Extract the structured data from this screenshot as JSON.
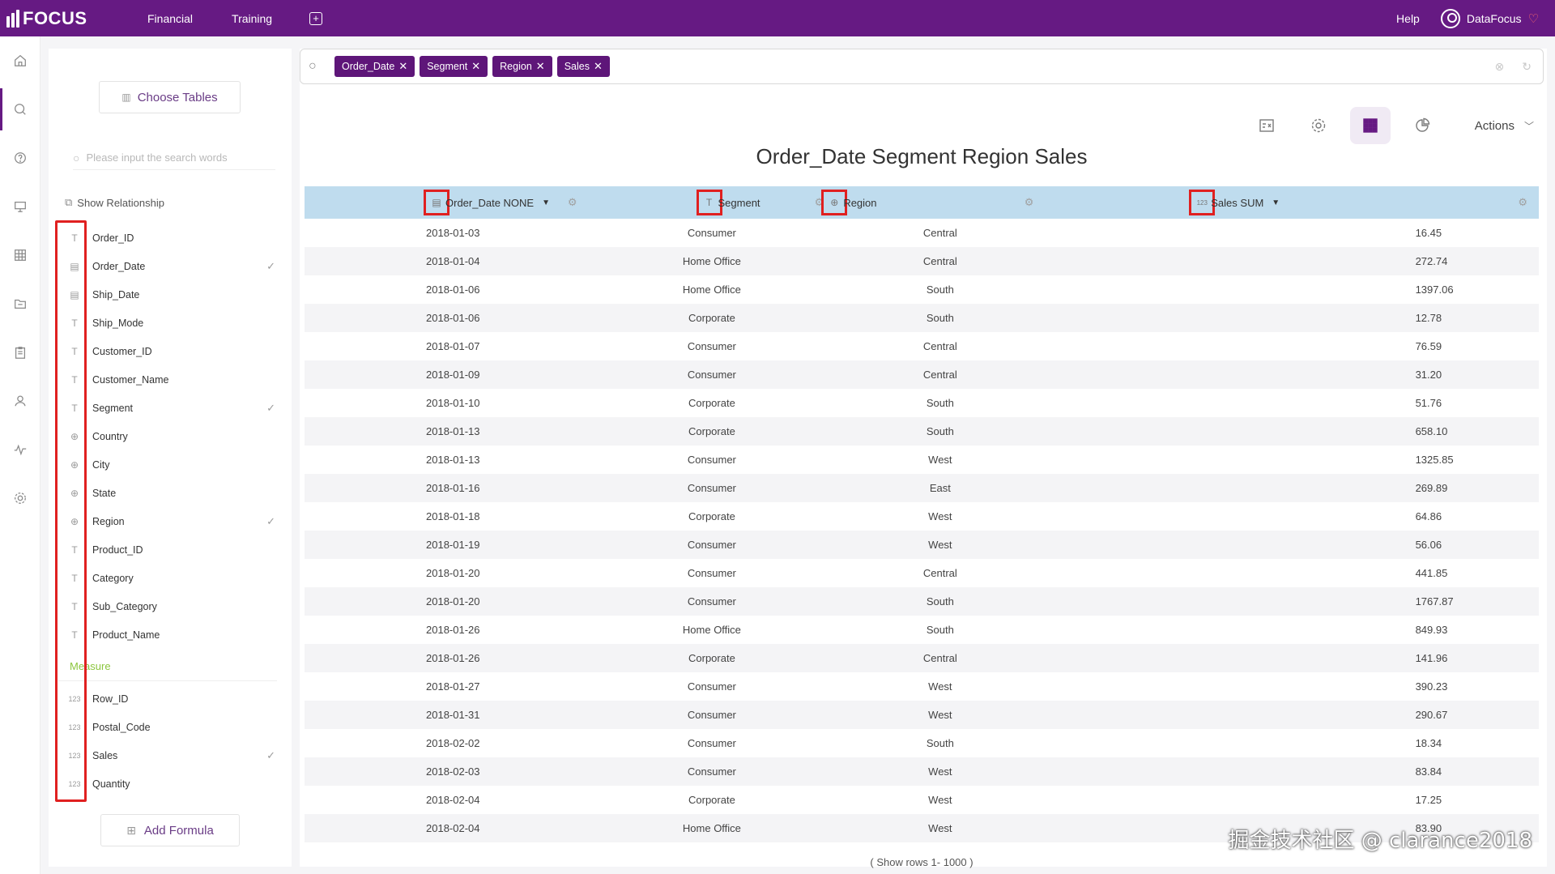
{
  "app": {
    "logo_text": "FOCUS",
    "user_name": "DataFocus"
  },
  "topnav": {
    "items": [
      "Financial",
      "Training"
    ],
    "help": "Help"
  },
  "panel": {
    "choose_tables": "Choose Tables",
    "search_placeholder": "Please input the search words",
    "show_relationship": "Show Relationship",
    "attribute_fields": [
      {
        "name": "Order_ID",
        "type": "text",
        "checked": false
      },
      {
        "name": "Order_Date",
        "type": "date",
        "checked": true
      },
      {
        "name": "Ship_Date",
        "type": "date",
        "checked": false
      },
      {
        "name": "Ship_Mode",
        "type": "text",
        "checked": false
      },
      {
        "name": "Customer_ID",
        "type": "text",
        "checked": false
      },
      {
        "name": "Customer_Name",
        "type": "text",
        "checked": false
      },
      {
        "name": "Segment",
        "type": "text",
        "checked": true
      },
      {
        "name": "Country",
        "type": "geo",
        "checked": false
      },
      {
        "name": "City",
        "type": "geo",
        "checked": false
      },
      {
        "name": "State",
        "type": "geo",
        "checked": false
      },
      {
        "name": "Region",
        "type": "geo",
        "checked": true
      },
      {
        "name": "Product_ID",
        "type": "text",
        "checked": false
      },
      {
        "name": "Category",
        "type": "text",
        "checked": false
      },
      {
        "name": "Sub_Category",
        "type": "text",
        "checked": false
      },
      {
        "name": "Product_Name",
        "type": "text",
        "checked": false
      }
    ],
    "measure_label": "Measure",
    "measure_fields": [
      {
        "name": "Row_ID",
        "type": "number",
        "checked": false
      },
      {
        "name": "Postal_Code",
        "type": "number",
        "checked": false
      },
      {
        "name": "Sales",
        "type": "number",
        "checked": true
      },
      {
        "name": "Quantity",
        "type": "number",
        "checked": false
      }
    ],
    "add_formula": "Add Formula"
  },
  "search": {
    "chips": [
      "Order_Date",
      "Segment",
      "Region",
      "Sales"
    ]
  },
  "toolbar": {
    "actions_label": "Actions"
  },
  "result": {
    "title": "Order_Date Segment Region Sales",
    "columns": [
      {
        "label": "Order_Date NONE",
        "icon": "date",
        "sortable": true
      },
      {
        "label": "Segment",
        "icon": "text",
        "sortable": false
      },
      {
        "label": "Region",
        "icon": "geo",
        "sortable": false
      },
      {
        "label": "Sales SUM",
        "icon": "number",
        "sortable": true
      }
    ],
    "rows": [
      [
        "2018-01-03",
        "Consumer",
        "Central",
        "16.45"
      ],
      [
        "2018-01-04",
        "Home Office",
        "Central",
        "272.74"
      ],
      [
        "2018-01-06",
        "Home Office",
        "South",
        "1397.06"
      ],
      [
        "2018-01-06",
        "Corporate",
        "South",
        "12.78"
      ],
      [
        "2018-01-07",
        "Consumer",
        "Central",
        "76.59"
      ],
      [
        "2018-01-09",
        "Consumer",
        "Central",
        "31.20"
      ],
      [
        "2018-01-10",
        "Corporate",
        "South",
        "51.76"
      ],
      [
        "2018-01-13",
        "Corporate",
        "South",
        "658.10"
      ],
      [
        "2018-01-13",
        "Consumer",
        "West",
        "1325.85"
      ],
      [
        "2018-01-16",
        "Consumer",
        "East",
        "269.89"
      ],
      [
        "2018-01-18",
        "Corporate",
        "West",
        "64.86"
      ],
      [
        "2018-01-19",
        "Consumer",
        "West",
        "56.06"
      ],
      [
        "2018-01-20",
        "Consumer",
        "Central",
        "441.85"
      ],
      [
        "2018-01-20",
        "Consumer",
        "South",
        "1767.87"
      ],
      [
        "2018-01-26",
        "Home Office",
        "South",
        "849.93"
      ],
      [
        "2018-01-26",
        "Corporate",
        "Central",
        "141.96"
      ],
      [
        "2018-01-27",
        "Consumer",
        "West",
        "390.23"
      ],
      [
        "2018-01-31",
        "Consumer",
        "West",
        "290.67"
      ],
      [
        "2018-02-02",
        "Consumer",
        "South",
        "18.34"
      ],
      [
        "2018-02-03",
        "Consumer",
        "West",
        "83.84"
      ],
      [
        "2018-02-04",
        "Corporate",
        "West",
        "17.25"
      ],
      [
        "2018-02-04",
        "Home Office",
        "West",
        "83.90"
      ]
    ],
    "footer": "( Show rows 1- 1000 )"
  },
  "watermark": "掘金技术社区 @ clarance2018"
}
